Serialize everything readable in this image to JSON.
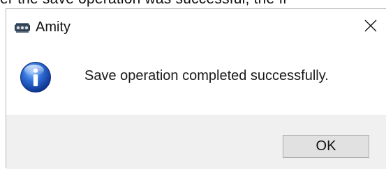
{
  "background_text": "er the save operation was successful, the fi",
  "window": {
    "title": "Amity",
    "app_icon": "amity-app-icon",
    "close_icon": "close-icon"
  },
  "message": {
    "icon": "information-icon",
    "text": "Save operation completed successfully."
  },
  "buttons": {
    "ok_label": "OK"
  }
}
